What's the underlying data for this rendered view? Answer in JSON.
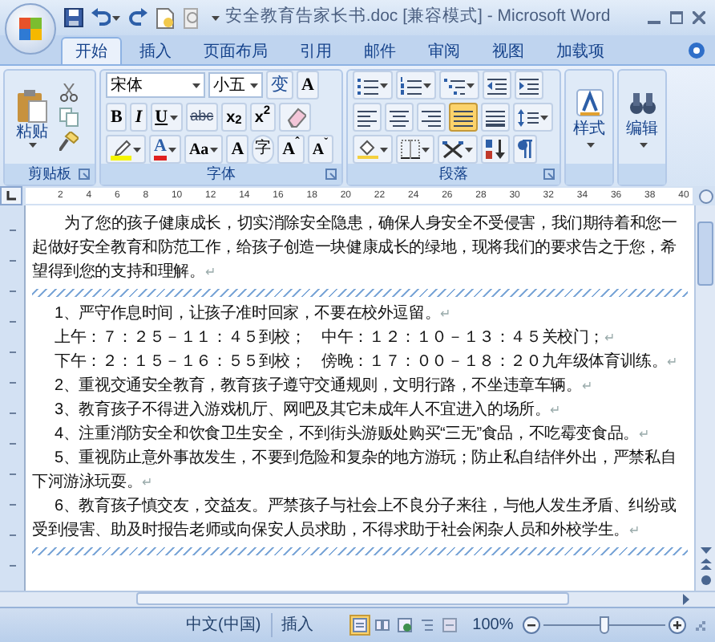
{
  "window": {
    "title": "安全教育告家长书.doc [兼容模式] - Microsoft Word"
  },
  "tabs": [
    {
      "label": "开始",
      "selected": true
    },
    {
      "label": "插入",
      "selected": false
    },
    {
      "label": "页面布局",
      "selected": false
    },
    {
      "label": "引用",
      "selected": false
    },
    {
      "label": "邮件",
      "selected": false
    },
    {
      "label": "审阅",
      "selected": false
    },
    {
      "label": "视图",
      "selected": false
    },
    {
      "label": "加载项",
      "selected": false
    }
  ],
  "ribbon": {
    "clipboard": {
      "label": "剪贴板",
      "paste": "粘贴"
    },
    "font": {
      "label": "字体",
      "font_name": "宋体",
      "font_size": "小五",
      "top_row": [
        {
          "kind": "phonetic-guide",
          "text": "变",
          "menu": false
        },
        {
          "kind": "char-border",
          "text": "A",
          "menu": false
        }
      ],
      "middle_row": [
        {
          "kind": "bold",
          "text": "B",
          "menu": false
        },
        {
          "kind": "italic",
          "text": "I",
          "menu": false
        },
        {
          "kind": "underline",
          "text": "U",
          "menu": true
        },
        {
          "kind": "strikethrough",
          "text": "abc",
          "menu": false
        },
        {
          "kind": "subscript",
          "text": "x$_{2}$",
          "menu": false
        },
        {
          "kind": "superscript",
          "text": "x$^{2}$",
          "menu": false
        },
        {
          "kind": "clear-format",
          "menu": false
        }
      ],
      "bottom_row": [
        {
          "kind": "highlight",
          "menu": true
        },
        {
          "kind": "font-color",
          "text": "A",
          "menu": true
        },
        {
          "kind": "change-case",
          "text": "Aa",
          "menu": true
        },
        {
          "kind": "char-shading",
          "text": "A",
          "menu": false
        },
        {
          "kind": "enclose",
          "text": "字",
          "menu": false
        },
        {
          "kind": "grow-font",
          "text": "A$^{ˆ}$",
          "menu": false
        },
        {
          "kind": "shrink-font",
          "text": "A$^{ˇ}$",
          "menu": false
        }
      ]
    },
    "paragraph": {
      "label": "段落",
      "top_row": [
        {
          "kind": "bullets",
          "menu": true,
          "selected": false
        },
        {
          "kind": "numbering",
          "menu": true,
          "selected": false
        },
        {
          "kind": "multilevel",
          "menu": true,
          "selected": false
        },
        {
          "kind": "decrease-indent",
          "menu": false,
          "selected": false
        },
        {
          "kind": "increase-indent",
          "menu": false,
          "selected": false
        }
      ],
      "middle_row": [
        {
          "kind": "align-left",
          "menu": false,
          "selected": false
        },
        {
          "kind": "align-center",
          "menu": false,
          "selected": false
        },
        {
          "kind": "align-right",
          "menu": false,
          "selected": false
        },
        {
          "kind": "justify",
          "menu": false,
          "selected": true
        },
        {
          "kind": "distributed",
          "menu": false,
          "selected": false
        },
        {
          "kind": "line-spacing",
          "menu": true,
          "selected": false
        }
      ],
      "bottom_row": [
        {
          "kind": "shading",
          "menu": true,
          "selected": false
        },
        {
          "kind": "borders",
          "menu": true,
          "selected": false
        },
        {
          "kind": "asian-layout",
          "menu": true,
          "selected": false
        },
        {
          "kind": "sort",
          "menu": false,
          "selected": false
        },
        {
          "kind": "show-marks",
          "menu": false,
          "selected": false
        }
      ]
    },
    "styles": {
      "label": "样式"
    },
    "editing": {
      "label": "编辑"
    }
  },
  "ruler": {
    "ticks": [
      "2",
      "4",
      "6",
      "8",
      "10",
      "12",
      "14",
      "16",
      "18",
      "20",
      "22",
      "24",
      "26",
      "28",
      "30",
      "32",
      "34",
      "36",
      "38",
      "40"
    ]
  },
  "document": {
    "paragraphs": [
      {
        "kind": "intro",
        "text": "为了您的孩子健康成长，切实消除安全隐患，确保人身安全不受侵害，我们期待着和您一起做好安全教育和防范工作，给孩子创造一块健康成长的绿地，现将我们的要求告之于您，希望得到您的支持和理解。",
        "mark": "↵"
      },
      {
        "kind": "section-break"
      },
      {
        "kind": "item",
        "text": "1、严守作息时间，让孩子准时回家，不要在校外逗留。",
        "mark": "↵"
      },
      {
        "kind": "item",
        "text": "上午：７：２５－１１：４５到校；　中午：１２：１０－１３：４５关校门；",
        "mark": "↵"
      },
      {
        "kind": "item",
        "text": "下午：２：１５－１６：５５到校；　傍晚：１７：００－１８：２０九年级体育训练。",
        "mark": "↵"
      },
      {
        "kind": "item",
        "text": "2、重视交通安全教育，教育孩子遵守交通规则，文明行路，不坐违章车辆。",
        "mark": "↵"
      },
      {
        "kind": "item",
        "text": "3、教育孩子不得进入游戏机厅、网吧及其它未成年人不宜进入的场所。",
        "mark": "↵"
      },
      {
        "kind": "item",
        "text": "4、注重消防安全和饮食卫生安全，不到街头游贩处购买“三无”食品，不吃霉变食品。",
        "mark": "↵"
      },
      {
        "kind": "item",
        "text": "5、重视防止意外事故发生，不要到危险和复杂的地方游玩；防止私自结伴外出，严禁私自下河游泳玩耍。",
        "mark": "↵"
      },
      {
        "kind": "item",
        "text": "6、教育孩子慎交友，交益友。严禁孩子与社会上不良分子来往，与他人发生矛盾、纠纷或受到侵害、助及时报告老师或向保安人员求助，不得求助于社会闲杂人员和外校学生。",
        "mark": "↵"
      },
      {
        "kind": "section-break"
      }
    ]
  },
  "status_bar": {
    "language": "中文(中国)",
    "mode": "插入",
    "views": [
      {
        "kind": "print-layout",
        "selected": true
      },
      {
        "kind": "reading",
        "selected": false
      },
      {
        "kind": "web-layout",
        "selected": false
      },
      {
        "kind": "outline",
        "selected": false
      },
      {
        "kind": "draft",
        "selected": false
      }
    ],
    "zoom": "100%",
    "zoom_slider": {
      "level": 0.5
    }
  }
}
